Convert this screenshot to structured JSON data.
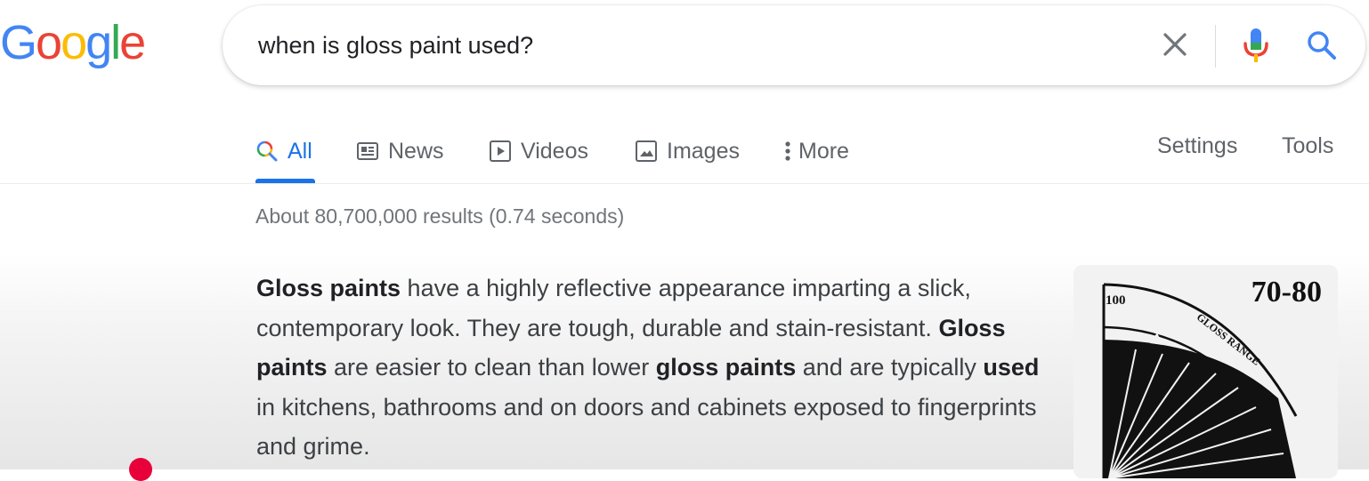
{
  "logo": {
    "letters": [
      "G",
      "o",
      "o",
      "g",
      "l",
      "e"
    ]
  },
  "search": {
    "query": "when is gloss paint used?"
  },
  "tabs": [
    {
      "label": "All",
      "icon": "search-icon",
      "active": true
    },
    {
      "label": "News",
      "icon": "news-icon"
    },
    {
      "label": "Videos",
      "icon": "video-icon"
    },
    {
      "label": "Images",
      "icon": "image-icon"
    },
    {
      "label": "More",
      "icon": "more-dots-icon"
    }
  ],
  "right_tabs": {
    "settings": "Settings",
    "tools": "Tools"
  },
  "results_stats": "About 80,700,000 results (0.74 seconds)",
  "snippet": {
    "segments": [
      {
        "text": "Gloss paints",
        "bold": true
      },
      {
        "text": " have a highly reflective appearance imparting a slick, contemporary look. They are tough, durable and stain-resistant. ",
        "bold": false
      },
      {
        "text": "Gloss paints",
        "bold": true
      },
      {
        "text": " are easier to clean than lower ",
        "bold": false
      },
      {
        "text": "gloss paints",
        "bold": true
      },
      {
        "text": " and are typically ",
        "bold": false
      },
      {
        "text": "used",
        "bold": true
      },
      {
        "text": " in kitchens, bathrooms and on doors and cabinets exposed to fingerprints and grime.",
        "bold": false
      }
    ]
  },
  "thumbnail": {
    "title": "70-80",
    "scale_start": "100",
    "arc_label": "GLOSS RANGE"
  },
  "colors": {
    "accent": "#1a73e8",
    "google_blue": "#4285F4",
    "google_red": "#EA4335",
    "google_yellow": "#FBBC05",
    "google_green": "#34A853",
    "cursor_dot": "#e8003a"
  }
}
